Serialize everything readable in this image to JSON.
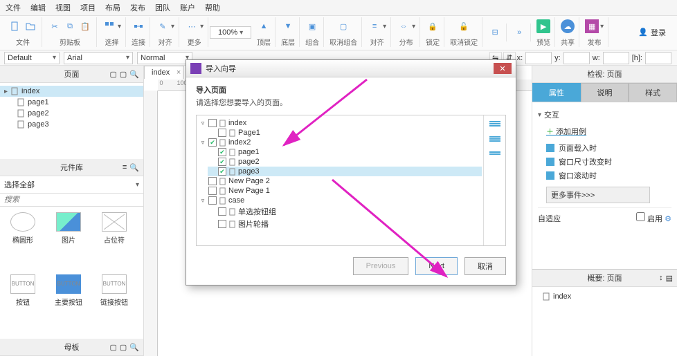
{
  "menu": {
    "items": [
      "文件",
      "编辑",
      "视图",
      "项目",
      "布局",
      "发布",
      "团队",
      "账户",
      "帮助"
    ]
  },
  "toolbar": {
    "groups": [
      {
        "label": "文件"
      },
      {
        "label": "剪贴板"
      },
      {
        "label": "选择"
      },
      {
        "label": "连接"
      },
      {
        "label": "对齐"
      },
      {
        "label": "更多"
      }
    ],
    "zoom": "100%",
    "right_groups": [
      "顶层",
      "底层",
      "组合",
      "取消组合",
      "对齐",
      "分布",
      "锁定",
      "取消锁定"
    ],
    "far": [
      "预览",
      "共享",
      "发布"
    ],
    "login": "登录"
  },
  "subtoolbar": {
    "style": "Default",
    "font": "Arial",
    "weight": "Normal",
    "coord": {
      "x": "x:",
      "y": "y:",
      "w": "w:",
      "h": "[h]:"
    }
  },
  "left": {
    "pages": {
      "title": "页面",
      "items": [
        {
          "name": "index",
          "sel": true,
          "lvl": 0
        },
        {
          "name": "page1",
          "lvl": 1
        },
        {
          "name": "page2",
          "lvl": 1
        },
        {
          "name": "page3",
          "lvl": 1
        }
      ]
    },
    "lib": {
      "title": "元件库",
      "selector": "选择全部",
      "search": "搜索",
      "widgets": [
        {
          "label": "椭圆形",
          "kind": "ellipse"
        },
        {
          "label": "图片",
          "kind": "image"
        },
        {
          "label": "占位符",
          "kind": "placeholder"
        },
        {
          "label": "按钮",
          "kind": "button",
          "text": "BUTTON"
        },
        {
          "label": "主要按钮",
          "kind": "primary",
          "text": "BUTTON"
        },
        {
          "label": "链接按钮",
          "kind": "link",
          "text": "BUTTON"
        }
      ]
    },
    "masters": {
      "title": "母板"
    }
  },
  "canvas": {
    "tab": "index"
  },
  "right": {
    "insp_title": "检视: 页面",
    "tabs": [
      "属性",
      "说明",
      "样式"
    ],
    "interaction": "交互",
    "add_case": "添加用例",
    "events": [
      "页面载入时",
      "窗口尺寸改变时",
      "窗口滚动时"
    ],
    "more": "更多事件>>>",
    "adaptive": "自适应",
    "enable": "启用",
    "outline_title": "概要: 页面",
    "outline_item": "index"
  },
  "dialog": {
    "title": "导入向导",
    "heading": "导入页面",
    "sub": "请选择您想要导入的页面。",
    "tree": [
      {
        "lvl": 0,
        "caret": "▿",
        "chk": false,
        "name": "index"
      },
      {
        "lvl": 1,
        "chk": false,
        "name": "Page1"
      },
      {
        "lvl": 0,
        "caret": "▿",
        "chk": true,
        "name": "index2"
      },
      {
        "lvl": 1,
        "chk": true,
        "name": "page1"
      },
      {
        "lvl": 1,
        "chk": true,
        "name": "page2"
      },
      {
        "lvl": 1,
        "chk": true,
        "name": "page3",
        "sel": true
      },
      {
        "lvl": 0,
        "chk": false,
        "name": "New Page 2"
      },
      {
        "lvl": 0,
        "chk": false,
        "name": "New Page 1"
      },
      {
        "lvl": 0,
        "caret": "▿",
        "chk": false,
        "name": "case"
      },
      {
        "lvl": 1,
        "chk": false,
        "name": "单选按钮组"
      },
      {
        "lvl": 1,
        "chk": false,
        "name": "图片轮播"
      }
    ],
    "btns": {
      "prev": "Previous",
      "next": "Next",
      "cancel": "取消"
    }
  }
}
